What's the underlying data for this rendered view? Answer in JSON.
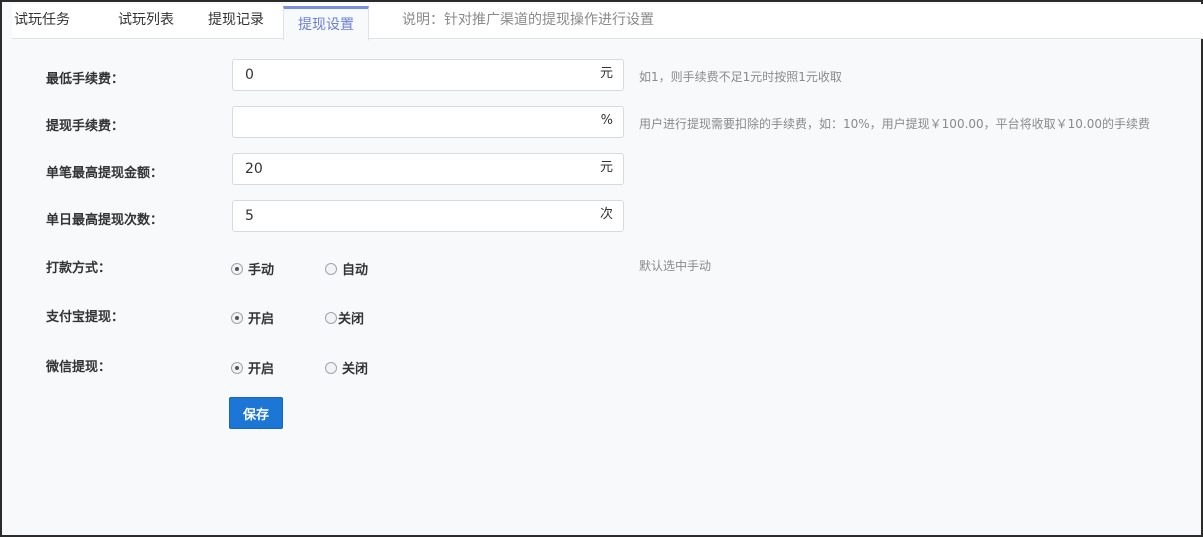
{
  "tabs": [
    {
      "label": "试玩任务"
    },
    {
      "label": "试玩列表"
    },
    {
      "label": "提现记录"
    },
    {
      "label": "提现设置",
      "active": true
    }
  ],
  "tab_note": "说明：针对推广渠道的提现操作进行设置",
  "form": {
    "min_fee": {
      "label": "最低手续费：",
      "value": "0",
      "unit": "元",
      "hint": "如1，则手续费不足1元时按照1元收取"
    },
    "fee_rate": {
      "label": "提现手续费：",
      "value": "",
      "unit": "%",
      "hint": "用户进行提现需要扣除的手续费，如：10%，用户提现￥100.00，平台将收取￥10.00的手续费"
    },
    "max_amount": {
      "label": "单笔最高提现金额：",
      "value": "20",
      "unit": "元"
    },
    "max_times": {
      "label": "单日最高提现次数：",
      "value": "5",
      "unit": "次"
    },
    "pay_method": {
      "label": "打款方式：",
      "options": [
        "手动",
        "自动"
      ],
      "selected": "手动",
      "hint": "默认选中手动"
    },
    "alipay": {
      "label": "支付宝提现：",
      "options": [
        "开启",
        "关闭"
      ],
      "selected": "开启"
    },
    "wechat": {
      "label": "微信提现：",
      "options": [
        "开启",
        "关闭"
      ],
      "selected": "开启"
    }
  },
  "save_label": "保存",
  "colors": {
    "accent": "#1b76d6",
    "active_tab": "#6a7fd8"
  }
}
